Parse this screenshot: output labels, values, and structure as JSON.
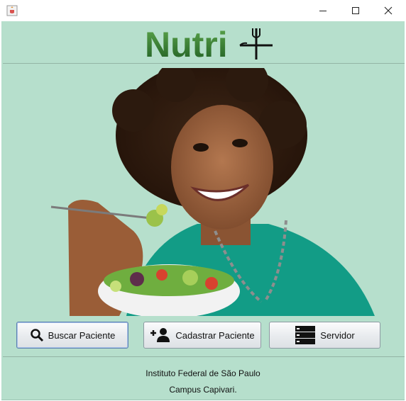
{
  "window": {
    "minimize_label": "–",
    "maximize_label": "☐",
    "close_label": "✕"
  },
  "header": {
    "logo_text": "Nutri"
  },
  "buttons": {
    "buscar": "Buscar Paciente",
    "cadastrar": "Cadastrar Paciente",
    "servidor": "Servidor"
  },
  "footer": {
    "line1": "Instituto Federal de São Paulo",
    "line2": "Campus Capivari."
  },
  "icons": {
    "app": "java-cup-icon",
    "buscar": "search-icon",
    "cadastrar": "add-user-icon",
    "servidor": "server-icon",
    "logo_mark": "fork-knife-icon"
  },
  "colors": {
    "background": "#b6dfcc",
    "logo_green": "#3f8a36",
    "logo_dark": "#1f5a22"
  }
}
